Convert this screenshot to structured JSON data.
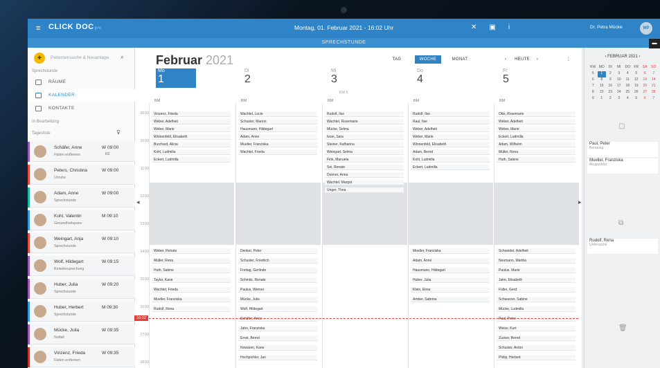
{
  "header": {
    "menu_icon": "≡",
    "logo": "CLICK DOC",
    "logo_sub": "pro",
    "title": "Montag, 01. Februar 2021 - 16:02 Uhr",
    "subtitle": "SPRECHSTUNDE",
    "user": "Dr. Petra Mücke",
    "avatar": "MP",
    "icons": [
      "tools-icon",
      "calendar-icon",
      "info-icon"
    ]
  },
  "sidebar": {
    "search_placeholder": "Patientensuche & Neuanlage",
    "section_sprechstunde": "Sprechstunde",
    "nav": [
      {
        "label": "RÄUME"
      },
      {
        "label": "KALENDER"
      },
      {
        "label": "KONTAKTE"
      }
    ],
    "section_bearbeitung": "In Bearbeitung",
    "tagesliste": "Tagesliste",
    "patients": [
      {
        "name": "Schäfer, Anne",
        "sub": "Fäden entfernen",
        "day": "W",
        "time": "09:00",
        "room": "R2",
        "color": "#9b59b6"
      },
      {
        "name": "Peters, Christina",
        "sub": "Unruhe",
        "day": "W",
        "time": "09:00",
        "room": "",
        "color": "#e74c3c"
      },
      {
        "name": "Adam, Anne",
        "sub": "Sprechstunde",
        "day": "W",
        "time": "09:00",
        "room": "",
        "color": "#1abc9c"
      },
      {
        "name": "Kohl, Valentin",
        "sub": "Gesundheitspass",
        "day": "M",
        "time": "09:10",
        "room": "",
        "color": "#3498db"
      },
      {
        "name": "Weingart, Anja",
        "sub": "Sprechstunde",
        "day": "W",
        "time": "09:10",
        "room": "",
        "color": "#e74c3c"
      },
      {
        "name": "Wolf, Hildegart",
        "sub": "Reisebesprechung",
        "day": "W",
        "time": "09:15",
        "room": "",
        "color": "#9b59b6"
      },
      {
        "name": "Huber, Julia",
        "sub": "Sprechstunde",
        "day": "W",
        "time": "09:20",
        "room": "",
        "color": "#9b59b6"
      },
      {
        "name": "Huber, Herbert",
        "sub": "Sprechstunde",
        "day": "M",
        "time": "09:30",
        "room": "",
        "color": "#3498db"
      },
      {
        "name": "Mücke, Julia",
        "sub": "Notfall",
        "day": "W",
        "time": "09:35",
        "room": "",
        "color": "#9b59b6"
      },
      {
        "name": "Vinzenz, Frieda",
        "sub": "Fäden entfernen",
        "day": "W",
        "time": "09:35",
        "room": "",
        "color": "#c0392b"
      }
    ]
  },
  "calendar": {
    "month": "Februar",
    "year": "2021",
    "views": [
      "TAG",
      "WOCHE",
      "MONAT"
    ],
    "today": "HEUTE",
    "kw": "KW 5",
    "days": [
      {
        "dow": "Mo",
        "num": "1"
      },
      {
        "dow": "Di",
        "num": "2"
      },
      {
        "dow": "Mi",
        "num": "3"
      },
      {
        "dow": "Do",
        "num": "4"
      },
      {
        "dow": "Fr",
        "num": "5"
      }
    ],
    "now": "16:02",
    "times": [
      "09:00",
      "10:00",
      "11:00",
      "12:00",
      "13:00",
      "14:00",
      "15:00",
      "16:00",
      "17:00",
      "18:00"
    ],
    "cols": [
      [
        "Vinzenz, Frieda",
        "Weber, Adelheit",
        "Weber, Marie",
        "Winnenfeld, Elisabeth",
        "Burchard, Alicia",
        "Kohl, Ludmilla",
        "Eckert, Ludmilla"
      ],
      [
        "Wachtel, Lucie",
        "Schuster, Marion",
        "Hausmann, Hildegart",
        "Adam, Anne",
        "Mueller, Franziska",
        "Wachtel, Frieda"
      ],
      [
        "Rudolf, Ilse",
        "Wachtel, Rosemarie",
        "Mücke, Selma",
        "Iwan, Sara",
        "Steiner, Katharina",
        "Weingart, Selma",
        "Fink, Manuela",
        "Sei, Renate",
        "Donner, Anna",
        "Wachtel, Margot",
        "Unger, Thea"
      ],
      [
        "Rudolf, Ilse",
        "Raul, Ilse",
        "Weber, Adelheit",
        "Weber, Marie",
        "Winnenfeld, Elisabeth",
        "Adam, Bernd",
        "Kohl, Ludmilla",
        "Eckert, Ludmilla"
      ],
      [
        "Otto, Rosemarie",
        "Weber, Adelheit",
        "Weber, Marie",
        "Eckert, Ludmilla",
        "Adam, Wilhelm",
        "Müller, Rena",
        "Huth, Sabine"
      ]
    ],
    "cols_pm": [
      [
        "Weber, Renate",
        "Müller, Rena",
        "Huth, Sabine",
        "Taylor, Kane",
        "Wachtel, Frieda",
        "Mueller, Franziska",
        "Rudolf, Rena"
      ],
      [
        "Denker, Peter",
        "Schuster, Friedrich",
        "Freitag, Gerlinde",
        "Schmitz, Renate",
        "Paulus, Werner",
        "Mücke, Julia",
        "Wolf, Hildegart",
        "Schäfer, Anne",
        "Jahn, Franziska",
        "Ernst, Bernd",
        "Nowaren, Kane",
        "Hochpichler, Jan"
      ],
      [],
      [
        "Moeller, Franziska",
        "Adam, Anne",
        "Hausmann, Hildegart",
        "Huber, Julia",
        "Klein, Elma",
        "Amber, Sabrina"
      ],
      [
        "Schneider, Adelheit",
        "Neumann, Martha",
        "Paulus, Marie",
        "Jahn, Elisabeth",
        "Füller, Gerd",
        "Schwarzer, Sabine",
        "Mücke, Ludmilla",
        "Paul, Peter",
        "Weiss, Kurt",
        "Zucker, Bernd",
        "Schuster, Anton",
        "Philip, Herbert"
      ]
    ]
  },
  "right": {
    "month": "FEBRUAR 2021",
    "dow": [
      "KW",
      "MO",
      "DI",
      "MI",
      "DO",
      "FR",
      "SA",
      "SO"
    ],
    "weeks": [
      [
        "5",
        "1",
        "2",
        "3",
        "4",
        "5",
        "6",
        "7"
      ],
      [
        "6",
        "8",
        "9",
        "10",
        "11",
        "12",
        "13",
        "14"
      ],
      [
        "7",
        "15",
        "16",
        "17",
        "18",
        "19",
        "20",
        "21"
      ],
      [
        "8",
        "22",
        "23",
        "24",
        "25",
        "26",
        "27",
        "28"
      ],
      [
        "9",
        "1",
        "2",
        "3",
        "4",
        "5",
        "6",
        "7"
      ]
    ],
    "wait1": [
      {
        "name": "Paul, Peter",
        "sub": "Beratung"
      },
      {
        "name": "Mueller, Franziska",
        "sub": "Akupunktur"
      }
    ],
    "wait2": [
      {
        "name": "Rudolf, Rena",
        "sub": "Untersuche"
      }
    ]
  }
}
